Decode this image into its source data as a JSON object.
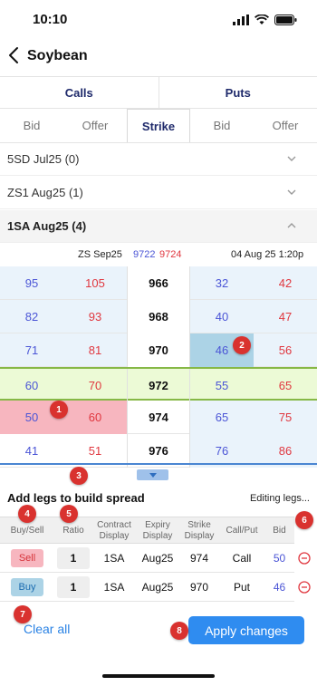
{
  "status": {
    "time": "10:10"
  },
  "nav": {
    "title": "Soybean"
  },
  "tabs": {
    "calls": "Calls",
    "puts": "Puts"
  },
  "columns": {
    "bid_left": "Bid",
    "offer_left": "Offer",
    "strike": "Strike",
    "bid_right": "Bid",
    "offer_right": "Offer"
  },
  "groups": [
    {
      "label": "5SD Jul25 (0)",
      "expanded": false
    },
    {
      "label": "ZS1 Aug25 (1)",
      "expanded": false
    },
    {
      "label": "1SA Aug25 (4)",
      "expanded": true
    }
  ],
  "underlying": {
    "name": "ZS Sep25",
    "bid": "9722",
    "offer": "9724",
    "timestamp": "04 Aug 25 1:20p"
  },
  "chain_rows": [
    {
      "call_bid": "95",
      "call_offer": "105",
      "strike": "966",
      "put_bid": "32",
      "put_offer": "42"
    },
    {
      "call_bid": "82",
      "call_offer": "93",
      "strike": "968",
      "put_bid": "40",
      "put_offer": "47"
    },
    {
      "call_bid": "71",
      "call_offer": "81",
      "strike": "970",
      "put_bid": "46",
      "put_offer": "56"
    },
    {
      "call_bid": "60",
      "call_offer": "70",
      "strike": "972",
      "put_bid": "55",
      "put_offer": "65"
    },
    {
      "call_bid": "50",
      "call_offer": "60",
      "strike": "974",
      "put_bid": "65",
      "put_offer": "75"
    },
    {
      "call_bid": "41",
      "call_offer": "51",
      "strike": "976",
      "put_bid": "76",
      "put_offer": "86"
    }
  ],
  "badges": [
    "1",
    "2",
    "3",
    "4",
    "5",
    "6",
    "7",
    "8"
  ],
  "spread": {
    "title": "Add legs to build spread",
    "status": "Editing legs...",
    "headers": {
      "buy_sell": "Buy/Sell",
      "ratio": "Ratio",
      "contract": "Contract Display",
      "expiry": "Expiry Display",
      "strike": "Strike Display",
      "call_put": "Call/Put",
      "bid": "Bid"
    },
    "legs": [
      {
        "side": "Sell",
        "ratio": "1",
        "contract": "1SA",
        "expiry": "Aug25",
        "strike": "974",
        "type": "Call",
        "bid": "50"
      },
      {
        "side": "Buy",
        "ratio": "1",
        "contract": "1SA",
        "expiry": "Aug25",
        "strike": "970",
        "type": "Put",
        "bid": "46"
      }
    ]
  },
  "actions": {
    "clear": "Clear all",
    "apply": "Apply changes"
  },
  "colors": {
    "accent": "#2f8cf0",
    "bid_text": "#4b55d6",
    "offer_text": "#e0373f",
    "atm_row": "#ecfad6",
    "sell_highlight": "#f7b6bf",
    "buy_highlight": "#acd3e6",
    "badge": "#d9322f"
  }
}
